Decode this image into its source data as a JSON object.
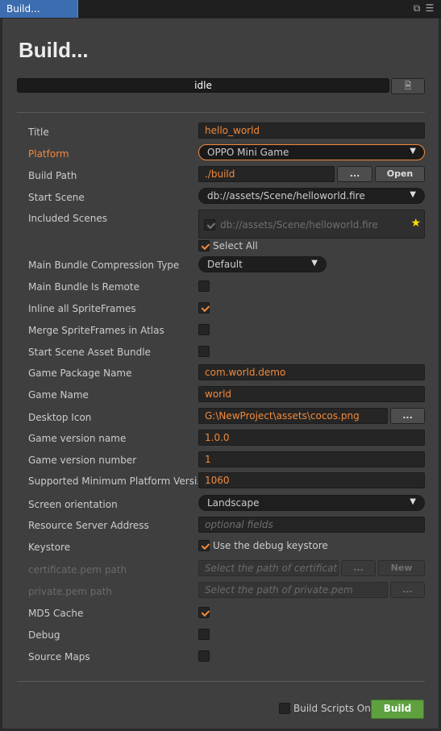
{
  "tab": {
    "title": "Build..."
  },
  "heading": "Build...",
  "progress": {
    "status": "idle"
  },
  "fields": {
    "title": {
      "label": "Title",
      "value": "hello_world"
    },
    "platform": {
      "label": "Platform",
      "value": "OPPO Mini Game"
    },
    "build_path": {
      "label": "Build Path",
      "value": "./build",
      "browse": "...",
      "open": "Open"
    },
    "start_scene": {
      "label": "Start Scene",
      "value": "db://assets/Scene/helloworld.fire"
    },
    "included_scenes": {
      "label": "Included Scenes",
      "scene": "db://assets/Scene/helloworld.fire",
      "select_all": "Select All"
    },
    "compression": {
      "label": "Main Bundle Compression Type",
      "value": "Default"
    },
    "bundle_remote": {
      "label": "Main Bundle Is Remote"
    },
    "inline_sprites": {
      "label": "Inline all SpriteFrames"
    },
    "merge_sprites": {
      "label": "Merge SpriteFrames in Atlas"
    },
    "start_scene_bundle": {
      "label": "Start Scene Asset Bundle"
    },
    "package_name": {
      "label": "Game Package Name",
      "value": "com.world.demo"
    },
    "game_name": {
      "label": "Game Name",
      "value": "world"
    },
    "desktop_icon": {
      "label": "Desktop Icon",
      "value": "G:\\NewProject\\assets\\cocos.png",
      "browse": "..."
    },
    "version_name": {
      "label": "Game version name",
      "value": "1.0.0"
    },
    "version_number": {
      "label": "Game version number",
      "value": "1"
    },
    "min_platform": {
      "label": "Supported Minimum Platform Versi...",
      "value": "1060"
    },
    "orientation": {
      "label": "Screen orientation",
      "value": "Landscape"
    },
    "resource_server": {
      "label": "Resource Server Address",
      "placeholder": "optional fields"
    },
    "keystore": {
      "label": "Keystore",
      "checkbox": "Use the debug keystore"
    },
    "certificate": {
      "label": "certificate.pem path",
      "placeholder": "Select the path of certificate.p",
      "browse": "...",
      "new": "New"
    },
    "private_pem": {
      "label": "private.pem path",
      "placeholder": "Select the path of private.pem",
      "browse": "..."
    },
    "md5_cache": {
      "label": "MD5 Cache"
    },
    "debug": {
      "label": "Debug"
    },
    "source_maps": {
      "label": "Source Maps"
    }
  },
  "footer": {
    "build_scripts_only": "Build Scripts Only",
    "build": "Build"
  },
  "colors": {
    "accent": "#f2893b",
    "build_button": "#5fa03f",
    "tab": "#3c6db0"
  },
  "icons": {
    "restore": "restore-icon",
    "menu": "menu-icon",
    "file": "file-icon",
    "star": "star-icon"
  }
}
